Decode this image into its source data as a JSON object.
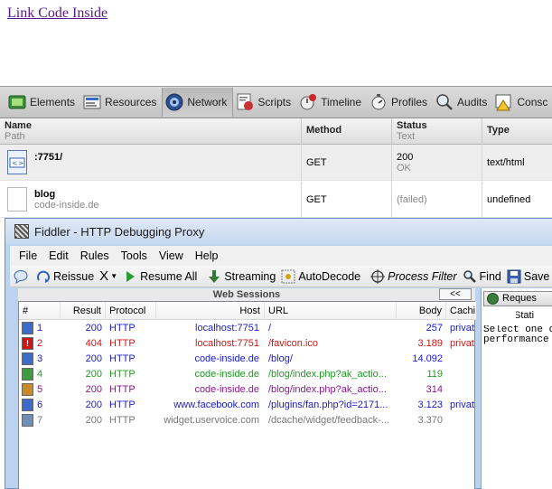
{
  "page": {
    "link_text": "Link Code Inside"
  },
  "inspector": {
    "tabs": [
      {
        "label": "Elements",
        "icon": "elements-icon"
      },
      {
        "label": "Resources",
        "icon": "resources-icon"
      },
      {
        "label": "Network",
        "icon": "network-icon",
        "active": true
      },
      {
        "label": "Scripts",
        "icon": "scripts-icon"
      },
      {
        "label": "Timeline",
        "icon": "timeline-icon"
      },
      {
        "label": "Profiles",
        "icon": "profiles-icon"
      },
      {
        "label": "Audits",
        "icon": "audits-icon"
      },
      {
        "label": "Consc",
        "icon": "console-icon"
      }
    ],
    "columns": {
      "name": "Name",
      "path": "Path",
      "method": "Method",
      "status": "Status",
      "text": "Text",
      "type": "Type"
    },
    "rows": [
      {
        "name": ":7751/",
        "path": "",
        "method": "GET",
        "status": "200",
        "status_text": "OK",
        "type": "text/html"
      },
      {
        "name": "blog",
        "path": "code-inside.de",
        "method": "GET",
        "status": "",
        "status_text": "(failed)",
        "type": "undefined"
      }
    ]
  },
  "fiddler": {
    "title": "Fiddler - HTTP Debugging Proxy",
    "menu": [
      "File",
      "Edit",
      "Rules",
      "Tools",
      "View",
      "Help"
    ],
    "toolbar": {
      "reissue": "Reissue",
      "remove": "X",
      "resume_all": "Resume All",
      "streaming": "Streaming",
      "autodecode": "AutoDecode",
      "process_filter": "Process Filter",
      "find": "Find",
      "save": "Save"
    },
    "web_sessions_label": "Web Sessions",
    "collapse_label": "<<",
    "session_columns": {
      "num": "#",
      "result": "Result",
      "protocol": "Protocol",
      "host": "Host",
      "url": "URL",
      "body": "Body",
      "caching": "Cachi"
    },
    "sessions": [
      {
        "num": "1",
        "result": "200",
        "protocol": "HTTP",
        "host": "localhost:7751",
        "url": "/",
        "body": "257",
        "caching": "privat",
        "color": "#1a1ad0",
        "icon_bg": "#3b6cc7"
      },
      {
        "num": "2",
        "result": "404",
        "protocol": "HTTP",
        "host": "localhost:7751",
        "url": "/favicon.ico",
        "body": "3.189",
        "caching": "privat",
        "color": "#d01515",
        "icon_bg": "#d01515"
      },
      {
        "num": "3",
        "result": "200",
        "protocol": "HTTP",
        "host": "code-inside.de",
        "url": "/blog/",
        "body": "14.092",
        "caching": "",
        "color": "#1a1ad0",
        "icon_bg": "#3b6cc7"
      },
      {
        "num": "4",
        "result": "200",
        "protocol": "HTTP",
        "host": "code-inside.de",
        "url": "/blog/index.php?ak_actio...",
        "body": "119",
        "caching": "",
        "color": "#1e9a1e",
        "icon_bg": "#3e9b3e"
      },
      {
        "num": "5",
        "result": "200",
        "protocol": "HTTP",
        "host": "code-inside.de",
        "url": "/blog/index.php?ak_actio...",
        "body": "314",
        "caching": "",
        "color": "#8b1a8b",
        "icon_bg": "#c98a2a"
      },
      {
        "num": "6",
        "result": "200",
        "protocol": "HTTP",
        "host": "www.facebook.com",
        "url": "/plugins/fan.php?id=2171...",
        "body": "3.123",
        "caching": "privat",
        "color": "#1a1ad0",
        "icon_bg": "#3b6cc7"
      },
      {
        "num": "7",
        "result": "200",
        "protocol": "HTTP",
        "host": "widget.uservoice.com",
        "url": "/dcache/widget/feedback-...",
        "body": "3.370",
        "caching": "",
        "color": "#777777",
        "icon_bg": "#6f8fb8"
      }
    ],
    "right_pane": {
      "tab": "Reques",
      "sub": "Stati",
      "text": "Select one o\nperformance"
    }
  }
}
